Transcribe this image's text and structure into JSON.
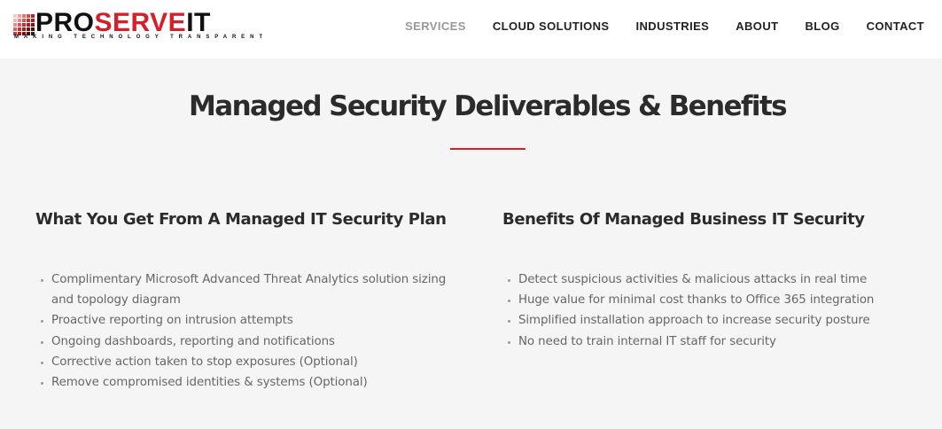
{
  "logo": {
    "part1": "PRO",
    "part2": "SERVE",
    "part3": "IT",
    "tagline": "MAKING TECHNOLOGY TRANSPARENT",
    "brand_color": "#d4202a"
  },
  "nav": {
    "items": [
      {
        "label": "SERVICES",
        "active": true
      },
      {
        "label": "CLOUD SOLUTIONS",
        "active": false
      },
      {
        "label": "INDUSTRIES",
        "active": false
      },
      {
        "label": "ABOUT",
        "active": false
      },
      {
        "label": "BLOG",
        "active": false
      },
      {
        "label": "CONTACT",
        "active": false
      }
    ]
  },
  "main": {
    "title": "Managed Security Deliverables & Benefits",
    "left": {
      "heading": "What You Get From A Managed IT Security Plan",
      "items": [
        "Complimentary Microsoft Advanced Threat Analytics solution sizing and topology diagram",
        "Proactive reporting on intrusion attempts",
        "Ongoing dashboards, reporting and notifications",
        "Corrective action taken to stop exposures (Optional)",
        "Remove compromised identities & systems (Optional)"
      ]
    },
    "right": {
      "heading": "Benefits Of Managed Business IT Security",
      "items": [
        "Detect suspicious activities & malicious attacks in real time",
        "Huge value for minimal cost thanks to Office 365 integration",
        "Simplified installation approach to increase security posture",
        "No need to train internal IT staff for security"
      ]
    }
  }
}
